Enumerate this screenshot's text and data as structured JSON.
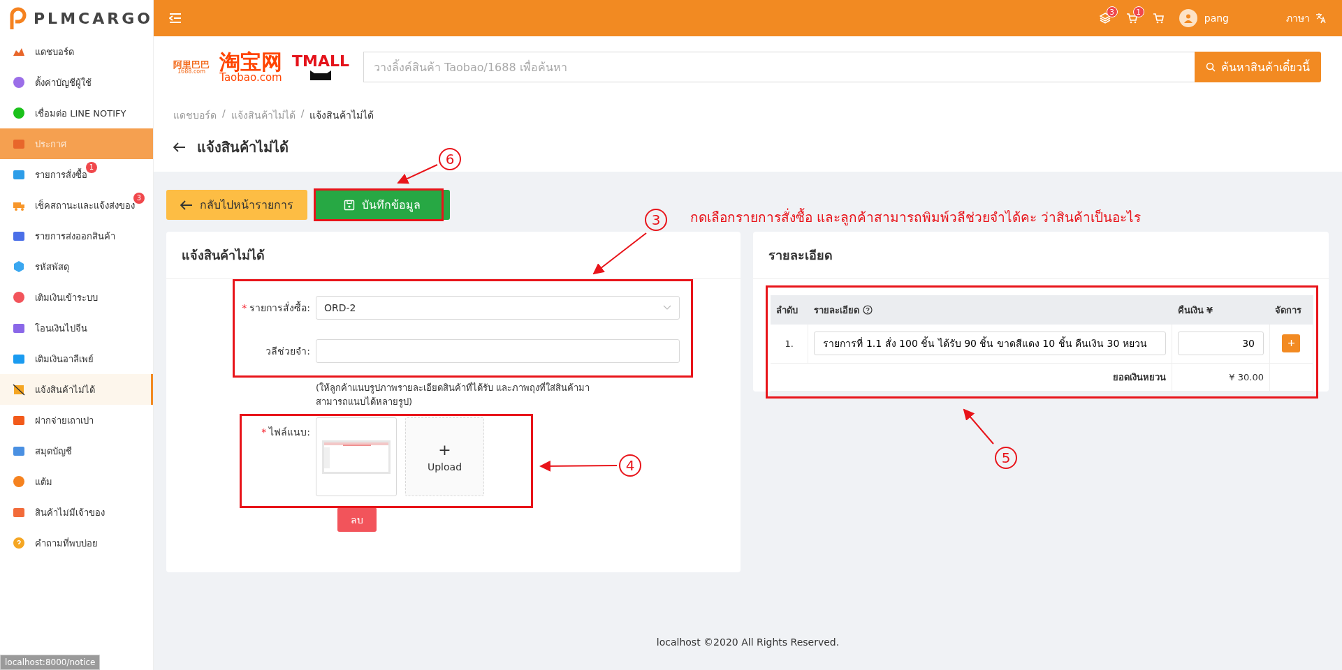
{
  "brand": {
    "name": "PLMCARGO"
  },
  "sidebar": {
    "items": [
      {
        "label": "แดชบอร์ด",
        "selected": false,
        "hovered": false
      },
      {
        "label": "ตั้งค่าบัญชีผู้ใช้",
        "selected": false,
        "hovered": false
      },
      {
        "label": "เชื่อมต่อ LINE NOTIFY",
        "selected": false,
        "hovered": false
      },
      {
        "label": "ประกาศ",
        "selected": false,
        "hovered": true
      },
      {
        "label": "รายการสั่งซื้อ",
        "selected": false,
        "hovered": false,
        "badge": "1"
      },
      {
        "label": "เช็คสถานะและแจ้งส่งของ",
        "selected": false,
        "hovered": false,
        "badge": "3"
      },
      {
        "label": "รายการส่งออกสินค้า",
        "selected": false,
        "hovered": false
      },
      {
        "label": "รหัสพัสดุ",
        "selected": false,
        "hovered": false
      },
      {
        "label": "เติมเงินเข้าระบบ",
        "selected": false,
        "hovered": false
      },
      {
        "label": "โอนเงินไปจีน",
        "selected": false,
        "hovered": false
      },
      {
        "label": "เติมเงินอาลีเพย์",
        "selected": false,
        "hovered": false
      },
      {
        "label": "แจ้งสินค้าไม่ได้",
        "selected": true,
        "hovered": false
      },
      {
        "label": "ฝากจ่ายเถาเปา",
        "selected": false,
        "hovered": false
      },
      {
        "label": "สมุดบัญชี",
        "selected": false,
        "hovered": false
      },
      {
        "label": "แต้ม",
        "selected": false,
        "hovered": false
      },
      {
        "label": "สินค้าไม่มีเจ้าของ",
        "selected": false,
        "hovered": false
      },
      {
        "label": "คำถามที่พบบ่อย",
        "selected": false,
        "hovered": false
      }
    ]
  },
  "header": {
    "layers_badge": "3",
    "cart_badge": "1",
    "user": "pang",
    "language": "ภาษา"
  },
  "search": {
    "logos": [
      {
        "kind": "alibaba",
        "text": "阿里巴巴",
        "sub": "1688.com"
      },
      {
        "kind": "taobao",
        "text": "淘宝网",
        "sub": "Taobao.com"
      },
      {
        "kind": "tmall",
        "text": "TMALL"
      }
    ],
    "placeholder": "วางลิ้งค์สินค้า Taobao/1688 เพื่อค้นหา",
    "button": "ค้นหาสินค้าเดี๋ยวนี้"
  },
  "breadcrumb": {
    "separator": "/",
    "items": [
      {
        "label": "แดชบอร์ด",
        "current": false
      },
      {
        "label": "แจ้งสินค้าไม่ได้",
        "current": false
      },
      {
        "label": "แจ้งสินค้าไม่ได้",
        "current": true
      }
    ]
  },
  "page_title": "แจ้งสินค้าไม่ได้",
  "actions": {
    "back": "กลับไปหน้ารายการ",
    "save": "บันทึกข้อมูล"
  },
  "form_card": {
    "title": "แจ้งสินค้าไม่ได้",
    "required_mark": "*",
    "fields": [
      {
        "label": "รายการสั่งซื้อ:",
        "required": true,
        "kind": "select",
        "value": "ORD-2"
      },
      {
        "label": "วลีช่วยจำ:",
        "required": false,
        "kind": "text"
      }
    ],
    "hint": "(ให้ลูกค้าแนบรูปภาพรายละเอียดสินค้าที่ได้รับ และภาพถุงที่ใส่สินค้ามาสามารถแนบได้หลายรูป)",
    "attachment": {
      "label": "ไฟล์แนบ:",
      "required": true,
      "upload": "Upload",
      "upload_symbol": "+",
      "delete": "ลบ"
    }
  },
  "detail_card": {
    "title": "รายละเอียด",
    "table": {
      "columns": [
        "ลำดับ",
        "รายละเอียด",
        "คืนเงิน ¥",
        "จัดการ"
      ],
      "rows": [
        {
          "index": "1.",
          "detail": "รายการที่ 1.1 สั่ง 100 ชิ้น ได้รับ 90 ชิ้น ขาดสีแดง 10 ชิ้น คืนเงิน 30 หยวน",
          "refund": "30",
          "action": "+"
        }
      ],
      "total_label": "ยอดเงินหยวน",
      "total": "¥ 30.00"
    }
  },
  "annotations": {
    "note": "กดเลือกรายการสั่งซื้อ และลูกค้าสามารถพิมพ์วลีช่วยจำได้คะ ว่าสินค้าเป็นอะไร",
    "callouts": [
      "6",
      "3",
      "4",
      "5"
    ]
  },
  "footer": "localhost ©2020 All Rights Reserved.",
  "status_bar": "localhost:8000/notice"
}
